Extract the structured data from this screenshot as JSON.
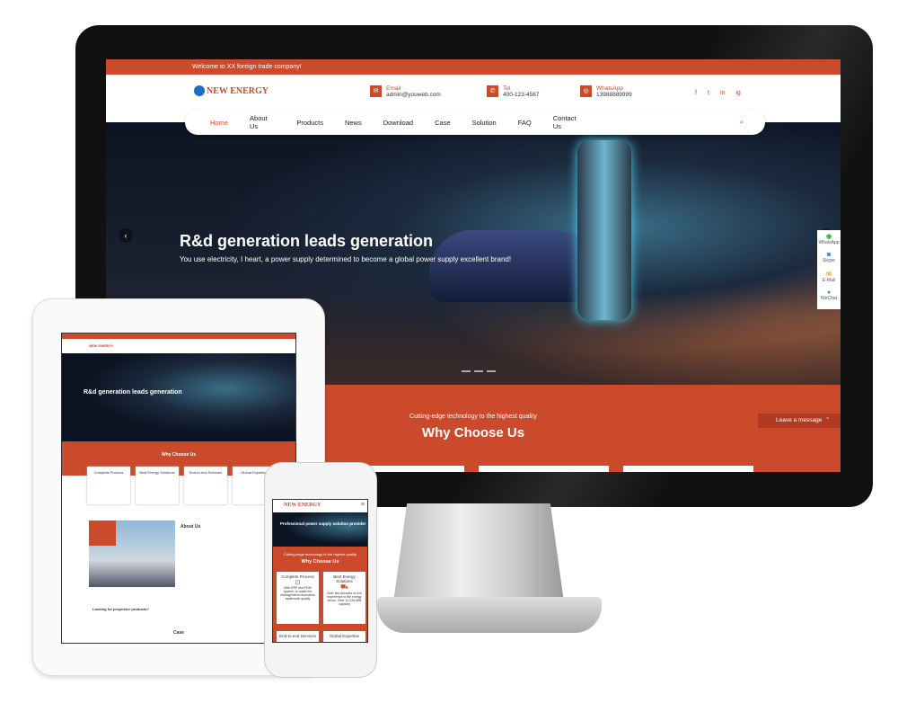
{
  "brand": {
    "name": "NEW ENERGY",
    "accent": "#cc4a2c"
  },
  "topbar": {
    "welcome": "Welcome to XX foreign trade company!"
  },
  "contacts": [
    {
      "icon": "email-icon",
      "label": "Email",
      "value": "admin@youweb.com"
    },
    {
      "icon": "phone-icon",
      "label": "Tel",
      "value": "400-123-4567"
    },
    {
      "icon": "whatsapp-icon",
      "label": "WhatsApp",
      "value": "13988889999"
    }
  ],
  "social": [
    "f",
    "t",
    "in",
    "ig"
  ],
  "nav": [
    "Home",
    "About Us",
    "Products",
    "News",
    "Download",
    "Case",
    "Solution",
    "FAQ",
    "Contact Us"
  ],
  "hero": {
    "title": "R&d generation leads generation",
    "subtitle": "You use electricity, I heart, a power supply determined to become a global power supply excellent brand!"
  },
  "why": {
    "kicker": "Cutting-edge technology to the highest quality",
    "title": "Why Choose Us"
  },
  "side_tools": [
    "WhatsApp",
    "Skype",
    "E-Mail",
    "WeChat"
  ],
  "message": "Leave a message",
  "tablet": {
    "cards": [
      "Complete Process",
      "Best Energy Solutions",
      "End-to-end Services",
      "Global Expertise"
    ],
    "about": "About Us",
    "looking": "Looking for proprietor products?",
    "case": "Case"
  },
  "phone": {
    "hero": "Professional power supply solution provider",
    "cards": [
      "Complete Process",
      "Best Energy Solutions",
      "End-to-end Services",
      "Global Expertise"
    ],
    "card1_text": "With ERP and PDM system, to make the management information systematic quality",
    "card2_text": "Over two decades of rich experience in the energy sector. Over 11 GW MW capacity"
  }
}
